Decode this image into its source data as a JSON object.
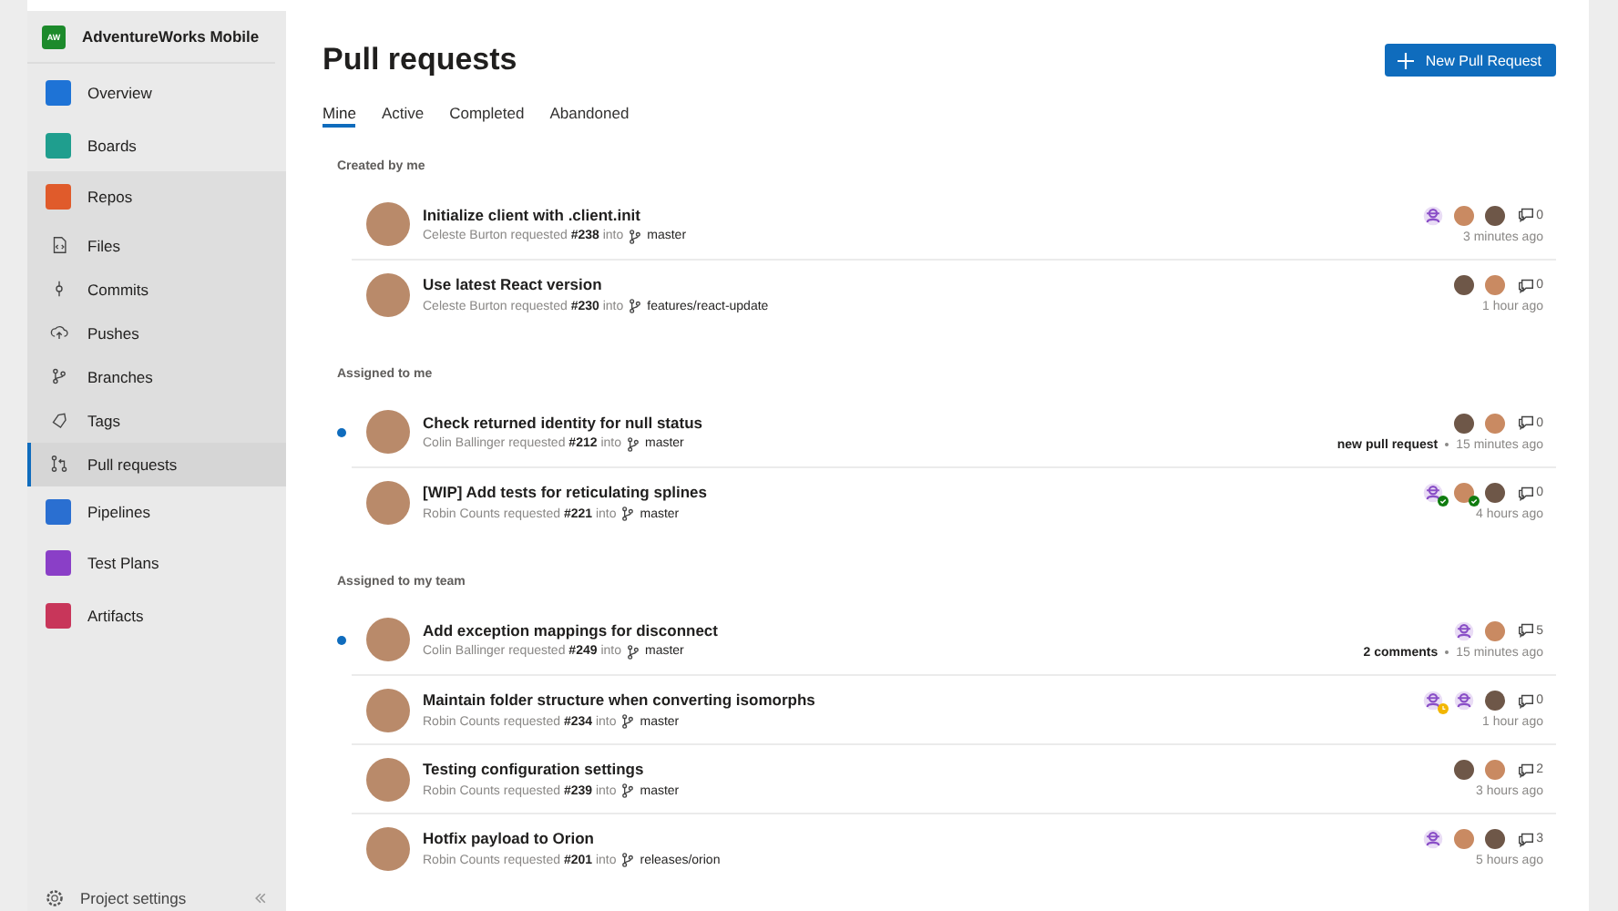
{
  "sidebar": {
    "project": {
      "badge": "AW",
      "name": "AdventureWorks Mobile"
    },
    "items": [
      {
        "label": "Overview",
        "selected": false
      },
      {
        "label": "Boards",
        "selected": false
      },
      {
        "label": "Repos",
        "selected": false,
        "expanded": true,
        "children": [
          {
            "label": "Files",
            "selected": false
          },
          {
            "label": "Commits",
            "selected": false
          },
          {
            "label": "Pushes",
            "selected": false
          },
          {
            "label": "Branches",
            "selected": false
          },
          {
            "label": "Tags",
            "selected": false
          },
          {
            "label": "Pull requests",
            "selected": true
          }
        ]
      },
      {
        "label": "Pipelines",
        "selected": false
      },
      {
        "label": "Test Plans",
        "selected": false
      },
      {
        "label": "Artifacts",
        "selected": false
      }
    ],
    "footer": {
      "label": "Project settings"
    }
  },
  "page": {
    "title": "Pull requests",
    "new_button": "New Pull Request",
    "tabs": [
      {
        "label": "Mine",
        "selected": true
      },
      {
        "label": "Active",
        "selected": false
      },
      {
        "label": "Completed",
        "selected": false
      },
      {
        "label": "Abandoned",
        "selected": false
      }
    ],
    "sections": [
      {
        "heading": "Created by me",
        "rows": [
          {
            "title": "Initialize client with .client.init",
            "byline": "Celeste Burton requested **#238** into",
            "branch": "master",
            "unread": false,
            "reviewers": [
              {
                "kind": "group",
                "approved": false,
                "waiting": false
              },
              {
                "kind": "person",
                "approved": false,
                "waiting": false
              },
              {
                "kind": "person",
                "approved": false,
                "waiting": false
              }
            ],
            "comments": "0",
            "time": "3 minutes ago"
          },
          {
            "title": "Use latest React version",
            "byline": "Celeste Burton requested **#230** into",
            "branch": "features/react-update",
            "unread": false,
            "reviewers": [
              {
                "kind": "person",
                "approved": false,
                "waiting": false
              },
              {
                "kind": "person",
                "approved": false,
                "waiting": false
              }
            ],
            "comments": "0",
            "time": "1 hour ago"
          }
        ]
      },
      {
        "heading": "Assigned to me",
        "rows": [
          {
            "title": "Check returned identity for null status",
            "byline": "Colin Ballinger requested **#212** into",
            "branch": "master",
            "unread": true,
            "reviewers": [
              {
                "kind": "person",
                "approved": false,
                "waiting": false
              },
              {
                "kind": "person",
                "approved": false,
                "waiting": false
              }
            ],
            "comments": "0",
            "status": "new pull request",
            "time": "15 minutes ago"
          },
          {
            "title": "[WIP] Add tests for reticulating splines",
            "byline": "Robin Counts requested **#221** into",
            "branch": "master",
            "unread": false,
            "reviewers": [
              {
                "kind": "group",
                "approved": true,
                "waiting": false
              },
              {
                "kind": "person",
                "approved": true,
                "waiting": false
              },
              {
                "kind": "person",
                "approved": false,
                "waiting": false
              }
            ],
            "comments": "0",
            "time": "4 hours ago"
          }
        ]
      },
      {
        "heading": "Assigned to my team",
        "rows": [
          {
            "title": "Add exception mappings for disconnect",
            "byline": "Colin Ballinger requested **#249** into",
            "branch": "master",
            "unread": true,
            "reviewers": [
              {
                "kind": "group",
                "approved": false,
                "waiting": false
              },
              {
                "kind": "person",
                "approved": false,
                "waiting": false
              }
            ],
            "comments": "5",
            "status": "2 comments",
            "time": "15 minutes ago"
          },
          {
            "title": "Maintain folder structure when converting isomorphs",
            "byline": "Robin Counts requested **#234** into",
            "branch": "master",
            "unread": false,
            "reviewers": [
              {
                "kind": "group",
                "approved": false,
                "waiting": true
              },
              {
                "kind": "group",
                "approved": false,
                "waiting": false
              },
              {
                "kind": "person",
                "approved": false,
                "waiting": false
              }
            ],
            "comments": "0",
            "time": "1 hour ago"
          },
          {
            "title": "Testing configuration settings",
            "byline": "Robin Counts requested **#239** into",
            "branch": "master",
            "unread": false,
            "reviewers": [
              {
                "kind": "person",
                "approved": false,
                "waiting": false
              },
              {
                "kind": "person",
                "approved": false,
                "waiting": false
              }
            ],
            "comments": "2",
            "time": "3 hours ago"
          },
          {
            "title": "Hotfix payload to Orion",
            "byline": "Robin Counts requested **#201** into",
            "branch": "releases/orion",
            "unread": false,
            "reviewers": [
              {
                "kind": "group",
                "approved": false,
                "waiting": false
              },
              {
                "kind": "person",
                "approved": false,
                "waiting": false
              },
              {
                "kind": "person",
                "approved": false,
                "waiting": false
              }
            ],
            "comments": "3",
            "time": "5 hours ago"
          }
        ]
      }
    ]
  }
}
